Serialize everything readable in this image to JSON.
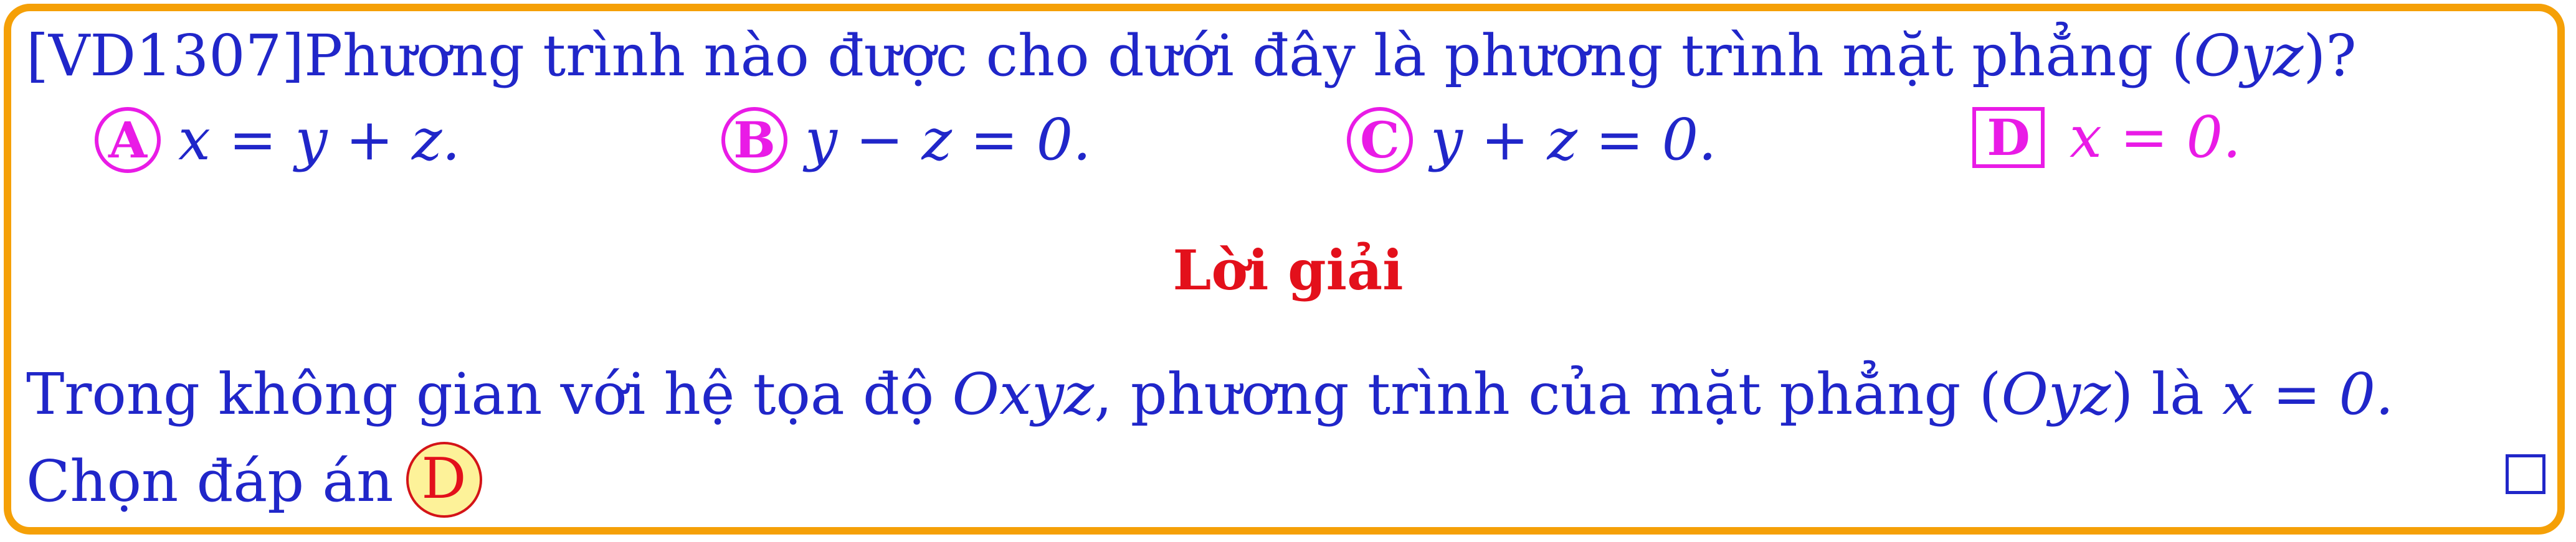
{
  "question": {
    "text": "[VD1307]Phương trình nào được cho dưới đây là phương trình mặt phẳng (Oyz)?",
    "code": "[VD1307]",
    "prompt": "Phương trình nào được cho dưới đây là phương trình mặt phẳng ",
    "plane_open": "(",
    "plane_name": "Oyz",
    "plane_close": ")?"
  },
  "options": [
    {
      "letter": "A",
      "expr": "x = y + z."
    },
    {
      "letter": "B",
      "expr": "y − z = 0."
    },
    {
      "letter": "C",
      "expr": "y + z = 0."
    },
    {
      "letter": "D",
      "expr": "x = 0."
    }
  ],
  "solution": {
    "heading": "Lời giải",
    "line1_a": "Trong không gian với hệ tọa độ ",
    "line1_b": "Oxyz",
    "line1_c": ", phương trình của mặt phẳng (",
    "line1_d": "Oyz",
    "line1_e": ") là ",
    "line1_f": "x = 0.",
    "line2": "Chọn đáp án",
    "answer": "D"
  },
  "colors": {
    "frame": "#f5a007",
    "text": "#2026c9",
    "option_marker": "#e91be6",
    "heading": "#e3101b",
    "answer_fill": "#fdf299"
  }
}
